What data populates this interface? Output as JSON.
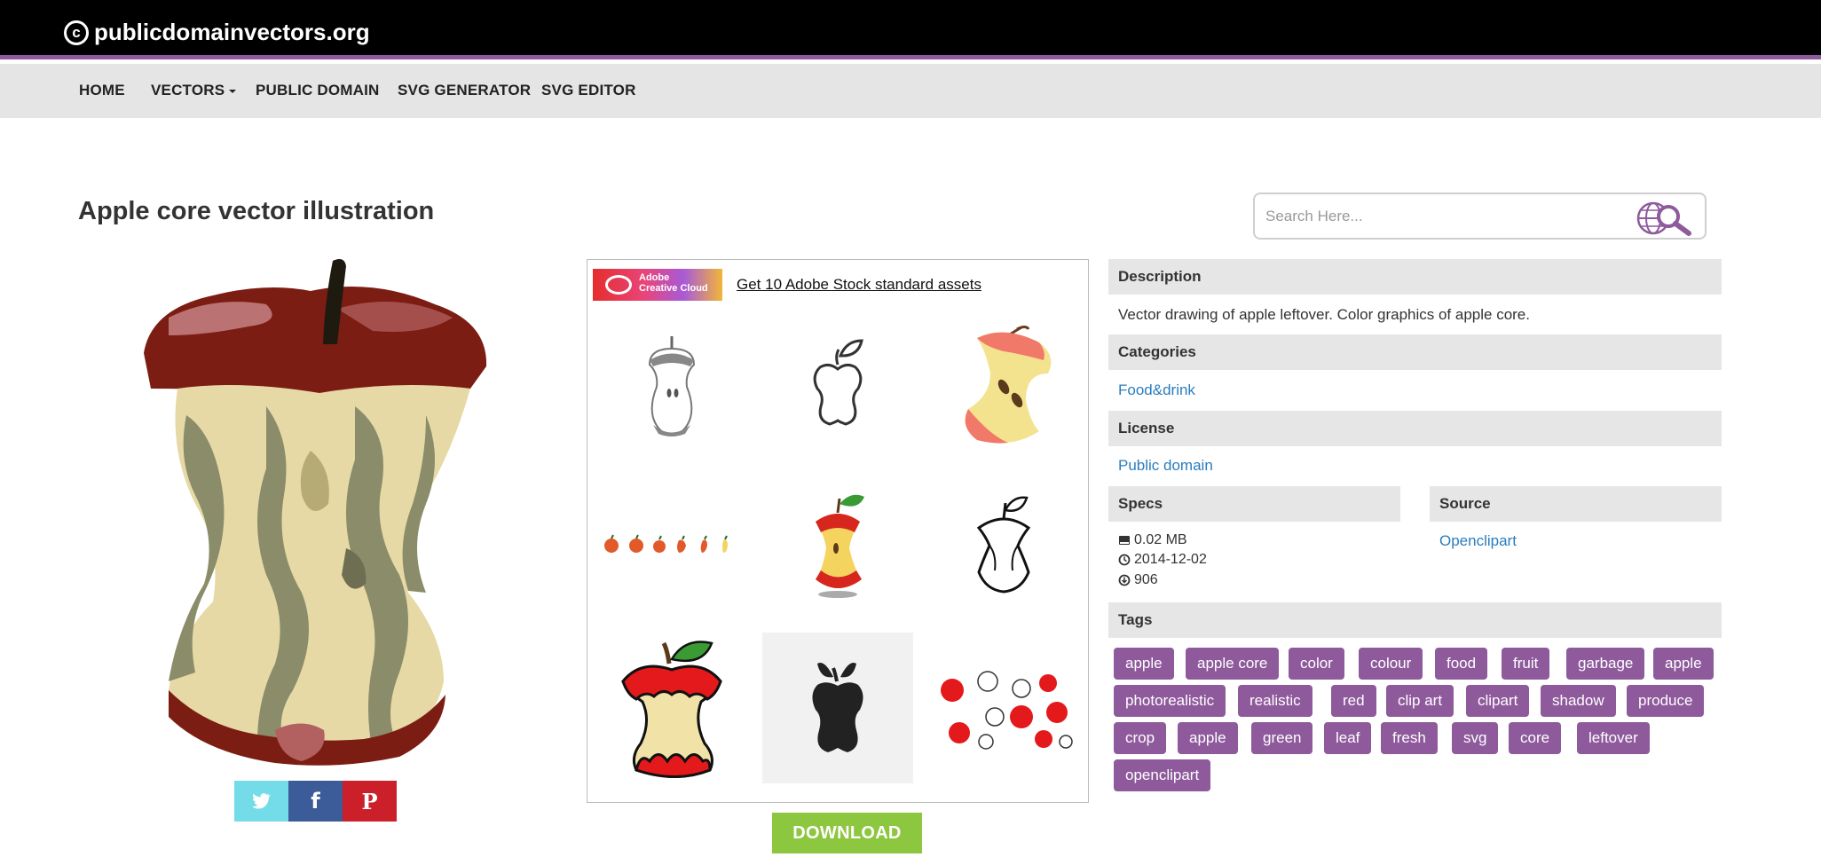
{
  "site": {
    "logo_text": "publicdomainvectors.org",
    "logo_mark": "c"
  },
  "nav": {
    "items": [
      {
        "label": "HOME"
      },
      {
        "label": "VECTORS"
      },
      {
        "label": "PUBLIC DOMAIN"
      },
      {
        "label": "SVG GENERATOR"
      },
      {
        "label": "SVG EDITOR"
      }
    ]
  },
  "page": {
    "title": "Apple core vector illustration"
  },
  "search": {
    "placeholder": "Search Here...",
    "icon": "globe-search-icon"
  },
  "share": {
    "twitter_icon": "twitter-icon",
    "facebook_icon": "facebook-icon",
    "pinterest_icon": "pinterest-icon"
  },
  "ad": {
    "badge_line1": "Adobe",
    "badge_line2": "Creative Cloud",
    "link_text": "Get 10 Adobe Stock standard assets"
  },
  "download": {
    "label": "DOWNLOAD"
  },
  "info": {
    "description_heading": "Description",
    "description_text": "Vector drawing of apple leftover. Color graphics of apple core.",
    "categories_heading": "Categories",
    "category": "Food&drink",
    "license_heading": "License",
    "license": "Public domain",
    "specs_heading": "Specs",
    "size": "0.02 MB",
    "date": "2014-12-02",
    "downloads": "906",
    "source_heading": "Source",
    "source": "Openclipart",
    "tags_heading": "Tags"
  },
  "tags": [
    "apple",
    "apple core",
    "color",
    "colour",
    "food",
    "fruit",
    "garbage",
    "apple",
    "photorealistic",
    "realistic",
    "red",
    "clip art",
    "clipart",
    "shadow",
    "produce",
    "crop",
    "apple",
    "green",
    "leaf",
    "fresh",
    "svg",
    "core",
    "leftover",
    "openclipart"
  ],
  "colors": {
    "accent": "#8e5a9c",
    "download": "#8dc63f",
    "link": "#2a7dbd",
    "header_bg": "#000000",
    "nav_bg": "#e5e5e5"
  }
}
